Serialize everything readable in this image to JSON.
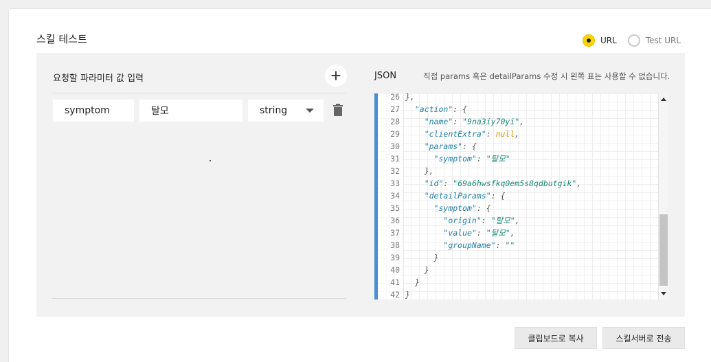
{
  "header": {
    "title": "스킬 테스트"
  },
  "radio": {
    "options": [
      {
        "label": "URL",
        "checked": true
      },
      {
        "label": "Test URL",
        "checked": false
      }
    ]
  },
  "params_panel": {
    "title": "요청할 파라미터 값 입력",
    "add_icon": "plus-icon",
    "rows": [
      {
        "key": "symptom",
        "value": "탈모",
        "type": "string"
      }
    ],
    "delete_icon": "trash-icon"
  },
  "json_panel": {
    "title": "JSON",
    "note": "직접 params 혹은 detailParams 수정 시 왼쪽 표는 사용할 수 없습니다.",
    "accent_color": "#4a8fd4",
    "lines": [
      {
        "n": "26",
        "t": "},"
      },
      {
        "n": "27",
        "t": "  \"action\": {"
      },
      {
        "n": "28",
        "t": "    \"name\": \"9na3iy70yi\","
      },
      {
        "n": "29",
        "t": "    \"clientExtra\": null,"
      },
      {
        "n": "30",
        "t": "    \"params\": {"
      },
      {
        "n": "31",
        "t": "      \"symptom\": \"탈모\""
      },
      {
        "n": "32",
        "t": "    },"
      },
      {
        "n": "33",
        "t": "    \"id\": \"69a6hwsfkq0em5s8qdbutgik\","
      },
      {
        "n": "34",
        "t": "    \"detailParams\": {"
      },
      {
        "n": "35",
        "t": "      \"symptom\": {"
      },
      {
        "n": "36",
        "t": "        \"origin\": \"탈모\","
      },
      {
        "n": "37",
        "t": "        \"value\": \"탈모\","
      },
      {
        "n": "38",
        "t": "        \"groupName\": \"\""
      },
      {
        "n": "39",
        "t": "      }"
      },
      {
        "n": "40",
        "t": "    }"
      },
      {
        "n": "41",
        "t": "  }"
      },
      {
        "n": "42",
        "t": "}"
      }
    ]
  },
  "footer": {
    "copy_label": "클립보드로 복사",
    "send_label": "스킬서버로 전송"
  },
  "colors": {
    "radio_checked": "#ffd400",
    "panel_bg": "#f2f2f2"
  }
}
